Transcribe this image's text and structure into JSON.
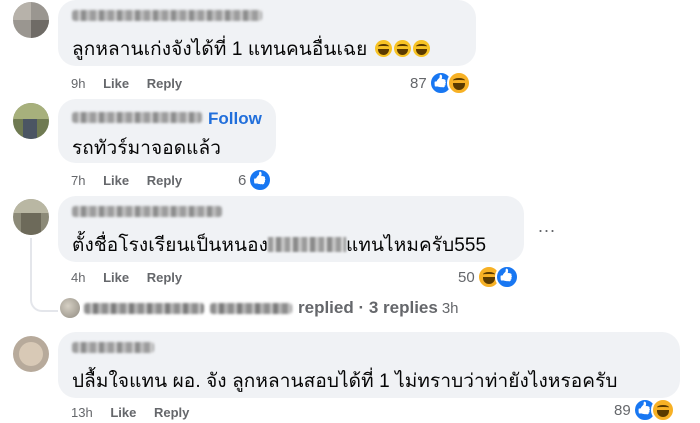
{
  "comments": [
    {
      "text": "ลูกหลานเก่งจังได้ที่ 1 แทนคนอื่นเฉย",
      "inline_emoji": [
        "laughing-emoji",
        "laughing-emoji",
        "laughing-emoji"
      ],
      "time": "9h",
      "like": "Like",
      "reply": "Reply",
      "reaction_count": "87",
      "reactions": [
        "like",
        "haha"
      ]
    },
    {
      "text": "รถทัวร์มาจอดแล้ว",
      "follow": "Follow",
      "time": "7h",
      "like": "Like",
      "reply": "Reply",
      "reaction_count": "6",
      "reactions": [
        "like"
      ]
    },
    {
      "text_before": "ตั้งชื่อโรงเรียนเป็นหนอง",
      "text_after": "แทนไหมครับ555",
      "more": "...",
      "time": "4h",
      "like": "Like",
      "reply": "Reply",
      "reaction_count": "50",
      "reactions": [
        "haha",
        "like"
      ],
      "replies_summary": "replied · 3 replies",
      "replies_time": "3h"
    },
    {
      "text": "ปลื้มใจแทน ผอ. จัง ลูกหลานสอบได้ที่ 1 ไม่ทราบว่าท่ายังไงหรอครับ",
      "time": "13h",
      "like": "Like",
      "reply": "Reply",
      "reaction_count": "89",
      "reactions": [
        "like",
        "haha"
      ]
    }
  ],
  "colors": {
    "bubble": "#f0f2f5",
    "meta_text": "#65676b",
    "follow": "#216fdb",
    "like_blue": "#1877f2",
    "haha_yellow": "#f7b125"
  }
}
